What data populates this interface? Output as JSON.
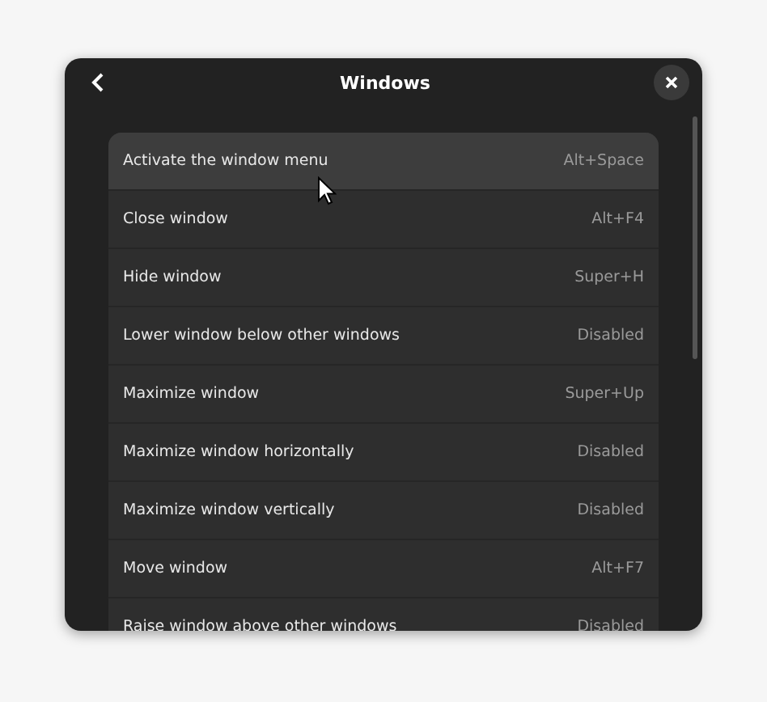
{
  "window": {
    "title": "Windows"
  },
  "shortcuts": [
    {
      "name": "Activate the window menu",
      "accel": "Alt+Space",
      "hovered": true
    },
    {
      "name": "Close window",
      "accel": "Alt+F4",
      "hovered": false
    },
    {
      "name": "Hide window",
      "accel": "Super+H",
      "hovered": false
    },
    {
      "name": "Lower window below other windows",
      "accel": "Disabled",
      "hovered": false
    },
    {
      "name": "Maximize window",
      "accel": "Super+Up",
      "hovered": false
    },
    {
      "name": "Maximize window horizontally",
      "accel": "Disabled",
      "hovered": false
    },
    {
      "name": "Maximize window vertically",
      "accel": "Disabled",
      "hovered": false
    },
    {
      "name": "Move window",
      "accel": "Alt+F7",
      "hovered": false
    },
    {
      "name": "Raise window above other windows",
      "accel": "Disabled",
      "hovered": false
    }
  ]
}
